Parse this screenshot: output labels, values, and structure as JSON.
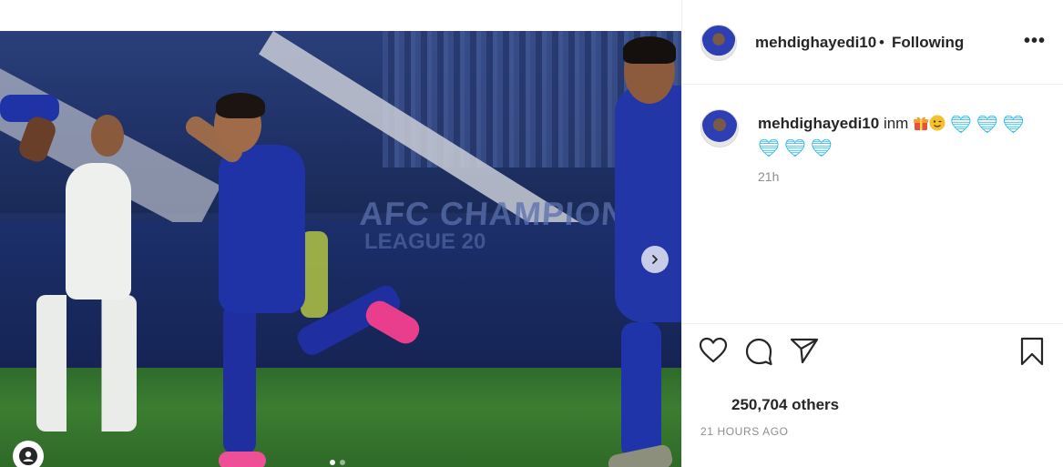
{
  "post": {
    "username": "mehdighayedi10",
    "separator": "•",
    "following_label": "Following",
    "more_label": "•••",
    "caption_text": "inm",
    "comment_time": "21h",
    "likes_text": "250,704 others",
    "post_time": "21 HOURS AGO",
    "media": {
      "stadium_text": "AFC CHAMPIONS",
      "stadium_text2": "LEAGUE 20",
      "carousel_dots": 2,
      "active_dot": 0
    }
  },
  "icons": {
    "like": "heart-icon",
    "comment": "comment-bubble-icon",
    "share": "paper-plane-icon",
    "save": "bookmark-icon",
    "next": "chevron-right-icon",
    "user": "user-silhouette-icon"
  },
  "colors": {
    "text": "#262626",
    "secondary": "#8e8e8e",
    "heart_emoji": "#1cb5e8",
    "jersey_blue": "#1f33a6"
  }
}
